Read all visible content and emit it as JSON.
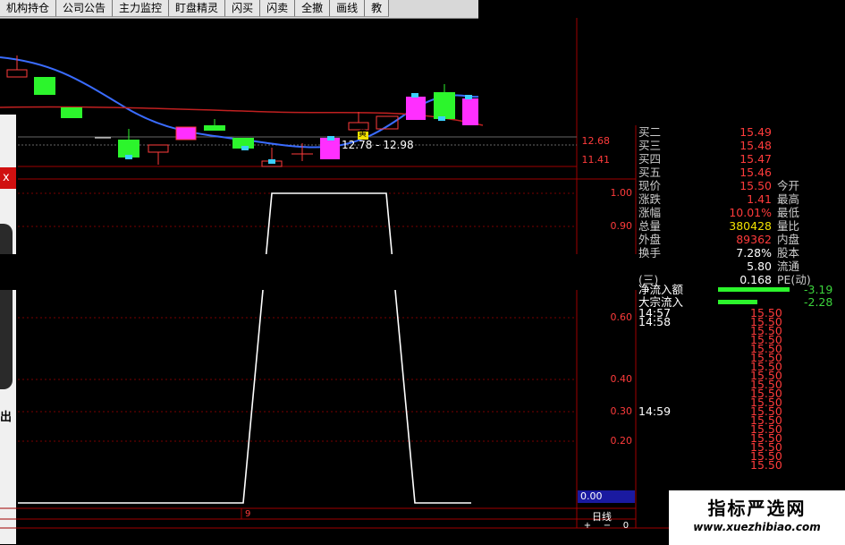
{
  "toolbar": {
    "buttons": [
      "机构持仓",
      "公司公告",
      "主力监控",
      "盯盘精灵",
      "闪买",
      "闪卖",
      "全撤",
      "画线",
      "教"
    ]
  },
  "kline": {
    "price_range_label": "12.78 - 12.98",
    "axis": [
      "12.68",
      "11.41"
    ],
    "tooltip_icon": "黄"
  },
  "indicator": {
    "axis": [
      "1.00",
      "0.90",
      "0.60",
      "0.40",
      "0.30",
      "0.20",
      "0.00"
    ],
    "cursor_label": "9"
  },
  "quote": {
    "rows": [
      {
        "label": "买二",
        "value": "15.49"
      },
      {
        "label": "买三",
        "value": "15.48"
      },
      {
        "label": "买四",
        "value": "15.47"
      },
      {
        "label": "买五",
        "value": "15.46"
      },
      {
        "label": "现价",
        "value": "15.50",
        "label2": "今开"
      },
      {
        "label": "涨跌",
        "value": "1.41",
        "label2": "最高"
      },
      {
        "label": "涨幅",
        "value": "10.01%",
        "label2": "最低"
      },
      {
        "label": "总量",
        "value": "380428",
        "label2": "量比"
      },
      {
        "label": "外盘",
        "value": "89362",
        "label2": "内盘"
      },
      {
        "label": "换手",
        "value": "7.28%",
        "label2": "股本"
      },
      {
        "label": "",
        "value": "5.80",
        "label2": "流通"
      },
      {
        "label": "(三)",
        "value": "0.168",
        "label2": "PE(动)"
      }
    ],
    "flows": [
      {
        "label": "净流入额",
        "value": "-3.19"
      },
      {
        "label": "大宗流入",
        "value": "-2.28"
      }
    ]
  },
  "ticks": [
    {
      "time": "14:57",
      "price": "15.50"
    },
    {
      "time": "14:58",
      "price": "15.50"
    },
    {
      "time": "",
      "price": "15.50"
    },
    {
      "time": "",
      "price": "15.50"
    },
    {
      "time": "",
      "price": "15.50"
    },
    {
      "time": "",
      "price": "15.50"
    },
    {
      "time": "",
      "price": "15.50"
    },
    {
      "time": "",
      "price": "15.50"
    },
    {
      "time": "",
      "price": "15.50"
    },
    {
      "time": "",
      "price": "15.50"
    },
    {
      "time": "",
      "price": "15.50"
    },
    {
      "time": "14:59",
      "price": "15.50"
    },
    {
      "time": "",
      "price": "15.50"
    },
    {
      "time": "",
      "price": "15.50"
    },
    {
      "time": "",
      "price": "15.50"
    },
    {
      "time": "",
      "price": "15.50"
    },
    {
      "time": "",
      "price": "15.50"
    },
    {
      "time": "",
      "price": "15.50"
    }
  ],
  "bottom": {
    "period": "日线",
    "zoom_buttons": [
      "+",
      "−",
      "0"
    ],
    "side_left": "出",
    "side_x": "x"
  },
  "watermark": {
    "title": "指标严选网",
    "url": "www.xuezhibiao.com"
  },
  "colors": {
    "up": "#ff2fff",
    "down": "#2cf52c",
    "axis": "#b00000",
    "line": "#ffffff"
  }
}
